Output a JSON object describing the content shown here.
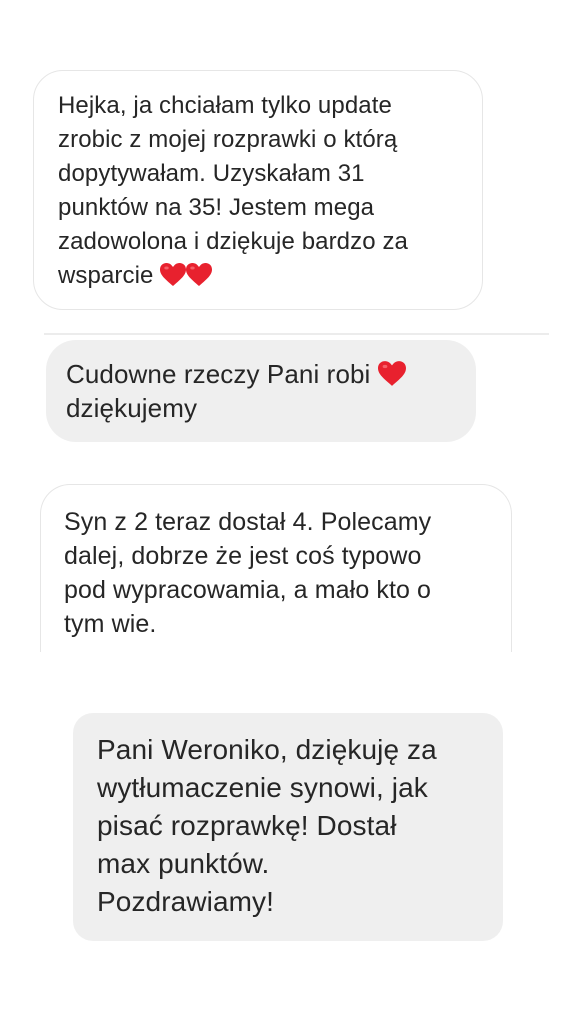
{
  "messages": [
    {
      "text": "Hejka, ja chciałam tylko update\nzrobic z mojej rozprawki o którą\ndopytywałam. Uzyskałam 31\npunktów na 35! Jestem mega\nzadowolona i dziękuje bardzo za\nwsparcie",
      "emoji": [
        "red-heart",
        "red-heart"
      ]
    },
    {
      "text_line1": "Cudowne rzeczy Pani robi",
      "emoji": [
        "red-heart"
      ],
      "text_line2": "dziękujemy"
    },
    {
      "text": "Syn z 2 teraz dostał 4. Polecamy\ndalej, dobrze że jest coś typowo\npod wypracowamia, a mało kto o\ntym wie."
    },
    {
      "text": "Pani Weroniko, dziękuję za\nwytłumaczenie synowi, jak\npisać rozprawkę! Dostał\nmax punktów.\nPozdrawiamy!"
    }
  ],
  "colors": {
    "bubble_fill": "#efefef",
    "bubble_border": "#e6e6e6",
    "text": "#262626",
    "heart": "#e8212e"
  }
}
